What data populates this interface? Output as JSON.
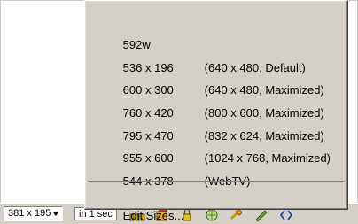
{
  "status_bar": {
    "size_value": "381 x 195",
    "status_text": "in 1 sec",
    "icons": [
      "connection-icon",
      "script-icon",
      "lock-icon",
      "globe-icon",
      "tools-icon",
      "pencil-icon",
      "code-icon"
    ]
  },
  "menu": {
    "items": [
      {
        "size": "592w",
        "desc": ""
      },
      {
        "size": "536 x 196",
        "desc": "(640 x 480, Default)"
      },
      {
        "size": "600 x 300",
        "desc": "(640 x 480, Maximized)"
      },
      {
        "size": "760 x 420",
        "desc": "(800 x 600, Maximized)"
      },
      {
        "size": "795 x 470",
        "desc": "(832 x 624, Maximized)"
      },
      {
        "size": "955 x 600",
        "desc": "(1024 x 768, Maximized)"
      },
      {
        "size": "544 x 378",
        "desc": "(WebTV)"
      }
    ],
    "edit_label": "Edit Sizes..."
  }
}
